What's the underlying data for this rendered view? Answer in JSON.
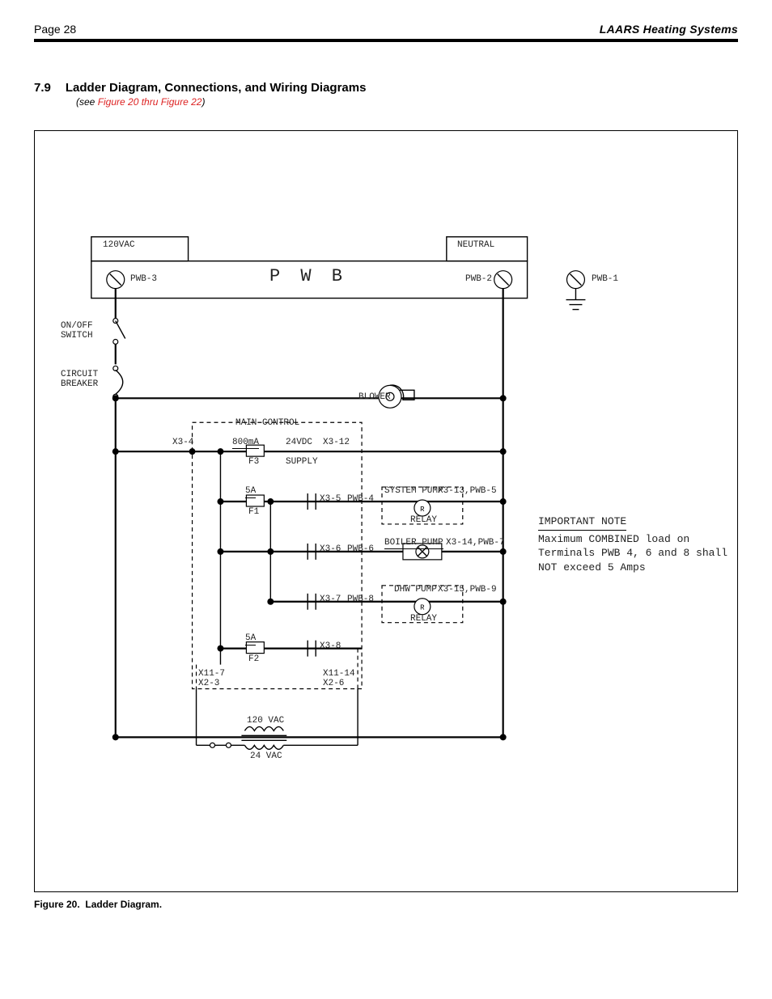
{
  "header": {
    "page": "Page 28",
    "brand": "LAARS Heating Systems"
  },
  "section": {
    "num": "7.9",
    "title": "Ladder Diagram, Connections, and Wiring Diagrams",
    "see_prefix": "(see ",
    "see_link": "Figure 20 thru Figure 22",
    "see_suffix": ")"
  },
  "figure": {
    "caption_label": "Figure 20.",
    "caption_text": "Ladder Diagram."
  },
  "diagram": {
    "pwb_title": "P W B",
    "left_header": "120VAC",
    "right_header": "NEUTRAL",
    "terminals": {
      "pwb3": "PWB-3",
      "pwb2": "PWB-2",
      "pwb1": "PWB-1"
    },
    "switch": "ON/OFF\nSWITCH",
    "breaker": "CIRCUIT\nBREAKER",
    "main_control": "MAIN CONTROL",
    "blower": "BLOWER",
    "row1": {
      "x34": "X3-4",
      "amp": "800mA",
      "f3": "F3",
      "dc": "24VDC",
      "x312": "X3-12",
      "supply": "SUPPLY"
    },
    "row2": {
      "f1top": "5A",
      "f1": "F1",
      "x35": "X3-5",
      "pwb4": "PWB-4",
      "pump": "SYSTEM PUMP",
      "right": "X3-13,PWB-5",
      "relay": "RELAY"
    },
    "row3": {
      "x36": "X3-6",
      "pwb6": "PWB-6",
      "pump": "BOILER PUMP",
      "right": "X3-14,PWB-7"
    },
    "row4": {
      "x37": "X3-7",
      "pwb8": "PWB-8",
      "pump": "DHW PUMP",
      "right": "X3-15,PWB-9",
      "relay": "RELAY"
    },
    "row5": {
      "f2top": "5A",
      "f2": "F2",
      "x38": "X3-8"
    },
    "row_gnd": {
      "left": "X11-7\nX2-3",
      "right": "X11-14\nX2-6"
    },
    "xfmr": {
      "top": "120 VAC",
      "bot": "24 VAC"
    },
    "note": {
      "heading": "IMPORTANT NOTE",
      "body": "Maximum COMBINED load\non Terminals PWB 4, 6\nand 8 shall NOT exceed\n5 Amps"
    }
  }
}
